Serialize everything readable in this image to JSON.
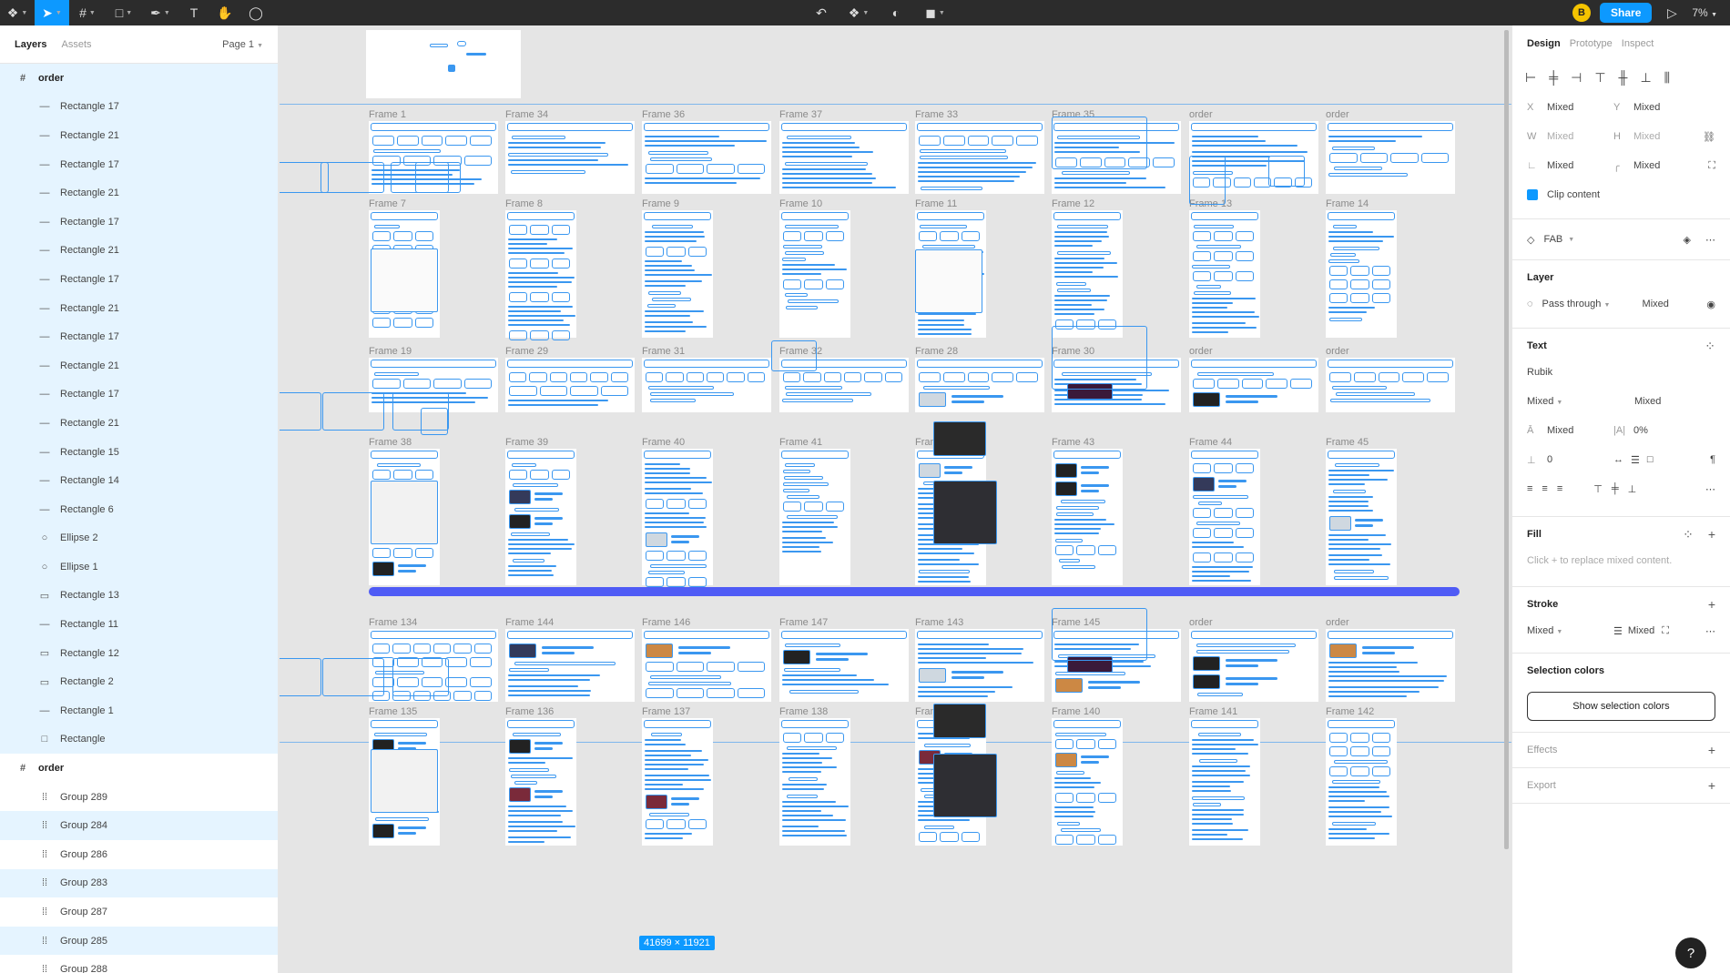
{
  "toolbar": {
    "share_label": "Share",
    "user_initial": "B",
    "zoom": "7%"
  },
  "left_panel": {
    "tabs": [
      "Layers",
      "Assets"
    ],
    "page": "Page 1",
    "layers": [
      {
        "name": "order",
        "type": "frame"
      },
      {
        "name": "Rectangle 17",
        "type": "line"
      },
      {
        "name": "Rectangle 21",
        "type": "line"
      },
      {
        "name": "Rectangle 17",
        "type": "line"
      },
      {
        "name": "Rectangle 21",
        "type": "line"
      },
      {
        "name": "Rectangle 17",
        "type": "line"
      },
      {
        "name": "Rectangle 21",
        "type": "line"
      },
      {
        "name": "Rectangle 17",
        "type": "line"
      },
      {
        "name": "Rectangle 21",
        "type": "line"
      },
      {
        "name": "Rectangle 17",
        "type": "line"
      },
      {
        "name": "Rectangle 21",
        "type": "line"
      },
      {
        "name": "Rectangle 17",
        "type": "line"
      },
      {
        "name": "Rectangle 21",
        "type": "line"
      },
      {
        "name": "Rectangle 15",
        "type": "line"
      },
      {
        "name": "Rectangle 14",
        "type": "line"
      },
      {
        "name": "Rectangle 6",
        "type": "line"
      },
      {
        "name": "Ellipse 2",
        "type": "ellipse"
      },
      {
        "name": "Ellipse 1",
        "type": "ellipse"
      },
      {
        "name": "Rectangle 13",
        "type": "pill"
      },
      {
        "name": "Rectangle 11",
        "type": "line"
      },
      {
        "name": "Rectangle 12",
        "type": "pill"
      },
      {
        "name": "Rectangle 2",
        "type": "pill"
      },
      {
        "name": "Rectangle 1",
        "type": "line"
      },
      {
        "name": "Rectangle",
        "type": "rect"
      },
      {
        "name": "order",
        "type": "frame"
      },
      {
        "name": "Group 289",
        "type": "group"
      },
      {
        "name": "Group 284",
        "type": "group"
      },
      {
        "name": "Group 286",
        "type": "group"
      },
      {
        "name": "Group 283",
        "type": "group"
      },
      {
        "name": "Group 287",
        "type": "group"
      },
      {
        "name": "Group 285",
        "type": "group"
      },
      {
        "name": "Group 288",
        "type": "group"
      }
    ]
  },
  "canvas": {
    "frames_row1": [
      "Frame 1",
      "Frame 34",
      "Frame 36",
      "Frame 37",
      "Frame 33",
      "Frame 35",
      "order",
      "order"
    ],
    "frames_row2": [
      "Frame 7",
      "Frame 8",
      "Frame 9",
      "Frame 10",
      "Frame 11",
      "Frame 12",
      "Frame 13",
      "Frame 14"
    ],
    "frames_row3": [
      "Frame 19",
      "Frame 29",
      "Frame 31",
      "Frame 32",
      "Frame 28",
      "Frame 30",
      "order",
      "order"
    ],
    "frames_row4": [
      "Frame 38",
      "Frame 39",
      "Frame 40",
      "Frame 41",
      "Frame 42",
      "Frame 43",
      "Frame 44",
      "Frame 45"
    ],
    "frames_row5": [
      "Frame 134",
      "Frame 144",
      "Frame 146",
      "Frame 147",
      "Frame 143",
      "Frame 145",
      "order",
      "order"
    ],
    "frames_row6": [
      "Frame 135",
      "Frame 136",
      "Frame 137",
      "Frame 138",
      "Frame 139",
      "Frame 140",
      "Frame 141",
      "Frame 142"
    ],
    "selection_size": "41699 × 11921",
    "accent_color": "#3a97f0",
    "divider_color": "#4f5bf5"
  },
  "right_panel": {
    "tabs": [
      "Design",
      "Prototype",
      "Inspect"
    ],
    "x_label": "X",
    "x_value": "Mixed",
    "y_label": "Y",
    "y_value": "Mixed",
    "w_label": "W",
    "w_value": "Mixed",
    "h_label": "H",
    "h_value": "Mixed",
    "rotation_value": "Mixed",
    "radius_value": "Mixed",
    "clip_content": "Clip content",
    "component": "FAB",
    "layer_title": "Layer",
    "blend": "Pass through",
    "opacity": "Mixed",
    "text_title": "Text",
    "font": "Rubik",
    "weight": "Mixed",
    "size": "Mixed",
    "line_height": "Mixed",
    "letter_spacing": "0%",
    "para_spacing": "0",
    "fill_title": "Fill",
    "fill_hint": "Click + to replace mixed content.",
    "stroke_title": "Stroke",
    "stroke_value": "Mixed",
    "stroke_weight": "Mixed",
    "selection_colors_title": "Selection colors",
    "show_selection_colors": "Show selection colors",
    "effects_title": "Effects",
    "export_title": "Export",
    "help": "?"
  }
}
